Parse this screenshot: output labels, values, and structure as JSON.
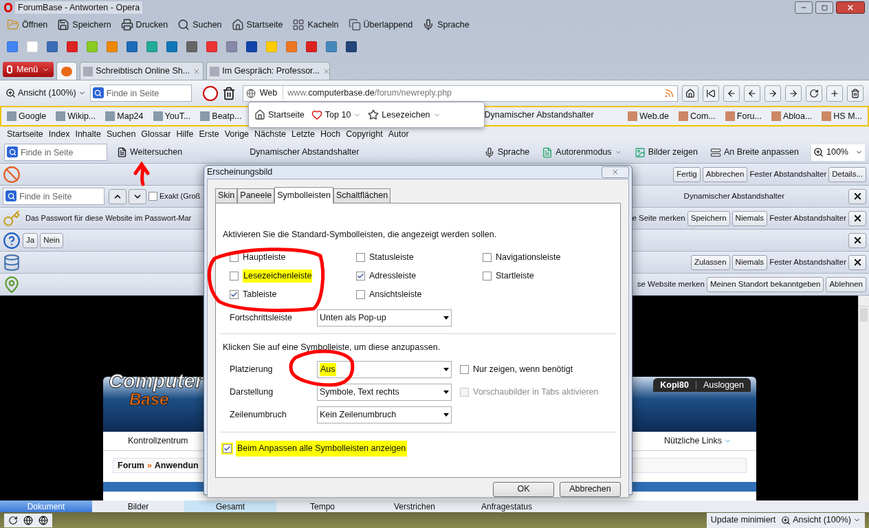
{
  "window": {
    "title": "ForumBase - Antworten - Opera"
  },
  "main_toolbar": [
    {
      "label": "Öffnen",
      "kind": "folder"
    },
    {
      "label": "Speichern",
      "kind": "save"
    },
    {
      "label": "Drucken",
      "kind": "print"
    },
    {
      "label": "Suchen",
      "kind": "search"
    },
    {
      "label": "Startseite",
      "kind": "home"
    },
    {
      "label": "Kacheln",
      "kind": "tile"
    },
    {
      "label": "Überlappend",
      "kind": "cascade"
    },
    {
      "label": "Sprache",
      "kind": "mic"
    }
  ],
  "tab_bar": {
    "menu_button": "Menü",
    "tabs": [
      {
        "kind": "icon",
        "selected": true
      },
      {
        "kind": "text",
        "label": "Schreibtisch Online Sh...",
        "selected": false
      },
      {
        "kind": "text",
        "label": "Im Gespräch: Professor...",
        "selected": false
      }
    ]
  },
  "address_bar": {
    "zoom": "Ansicht (100%)",
    "find_placeholder": "Finde in Seite",
    "search_engine": "Web",
    "url": "www.**computerbase.de**/forum/newreply.php"
  },
  "bookmarks_bar": {
    "left": [
      "Google",
      "Wikip...",
      "Map24",
      "YouT...",
      "Beatp..."
    ],
    "right": [
      "Web.de",
      "Com...",
      "Foru...",
      "Abloa...",
      "HS M..."
    ]
  },
  "bookmark_popup": {
    "items": [
      {
        "label": "Startseite",
        "kind": "home",
        "dropdown": false
      },
      {
        "label": "Top 10",
        "kind": "heart",
        "dropdown": true
      },
      {
        "label": "Lesezeichen",
        "kind": "star",
        "dropdown": true
      }
    ],
    "spacer": "Dynamischer Abstandshalter"
  },
  "navigation_menu": [
    "Startseite",
    "Index",
    "Inhalte",
    "Suchen",
    "Glossar",
    "Hilfe",
    "Erste",
    "Vorige",
    "Nächste",
    "Letzte",
    "Hoch",
    "Copyright",
    "Autor"
  ],
  "view_toolbar": {
    "find_placeholder": "Finde in Seite",
    "find_next": "Weitersuchen",
    "spacer": "Dynamischer Abstandshalter",
    "items": [
      {
        "label": "Sprache",
        "kind": "mic",
        "dropdown": false
      },
      {
        "label": "Autorenmodus",
        "kind": "author",
        "dropdown": true
      },
      {
        "label": "Bilder zeigen",
        "kind": "image",
        "dropdown": false
      },
      {
        "label": "An Breite anpassen",
        "kind": "fit",
        "dropdown": false
      }
    ],
    "zoom": "100%"
  },
  "info_bars": [
    {
      "kind": "stop",
      "buttons": [
        "Fertig",
        "Abbrechen"
      ],
      "spacer": "Fester Abstandshalter",
      "end_button": "Details...",
      "closable": false
    },
    {
      "kind": "find",
      "find_placeholder": "Finde in Seite",
      "option": {
        "label": "Exakt (Groß",
        "checked": false
      },
      "right_text": "Dynamischer Abstandshalter",
      "closable": true
    },
    {
      "kind": "key",
      "left_text": "Das Passwort für diese Website im Passwort-Mar",
      "right_text": "e Seite merken",
      "buttons": [
        "Speichern",
        "Niemals"
      ],
      "spacer": "Fester Abstandshalter",
      "closable": true
    },
    {
      "kind": "question",
      "left_buttons": [
        "Ja",
        "Nein"
      ],
      "closable": true
    },
    {
      "kind": "database",
      "buttons": [
        "Zulassen",
        "Niemals"
      ],
      "spacer": "Fester Abstandshalter",
      "closable": true
    },
    {
      "kind": "pin",
      "right_text": "se Website merken",
      "buttons": [
        "Meinen Standort bekanntgeben",
        "Ablehnen"
      ],
      "closable": false
    }
  ],
  "page": {
    "logo": [
      "Computer",
      "Base"
    ],
    "user": "Kopi80",
    "logout": "Ausloggen",
    "nav": [
      "Kontrollzentrum",
      "Nützliche Links"
    ],
    "breadcrumb": [
      "Forum",
      "Anwendun"
    ],
    "separator": "»"
  },
  "dialog": {
    "title": "Erscheinungsbild",
    "tabs": [
      {
        "label": "Skin",
        "selected": false
      },
      {
        "label": "Paneele",
        "selected": false
      },
      {
        "label": "Symbolleisten",
        "selected": true
      },
      {
        "label": "Schaltflächen",
        "selected": false
      }
    ],
    "intro": "Aktivieren Sie die Standard-Symbolleisten, die angezeigt werden sollen.",
    "toolbars": [
      {
        "label": "Hauptleiste",
        "checked": false,
        "highlighted": false
      },
      {
        "label": "Statusleiste",
        "checked": false,
        "highlighted": false
      },
      {
        "label": "Navigationsleiste",
        "checked": false,
        "highlighted": false
      },
      {
        "label": "Lesezeichenleiste",
        "checked": false,
        "highlighted": true
      },
      {
        "label": "Adressleiste",
        "checked": true,
        "highlighted": false
      },
      {
        "label": "Startleiste",
        "checked": false,
        "highlighted": false
      },
      {
        "label": "Tableiste",
        "checked": true,
        "highlighted": false
      },
      {
        "label": "Ansichtsleiste",
        "checked": false,
        "highlighted": false
      }
    ],
    "progress": {
      "label": "Fortschrittsleiste",
      "value": "Unten als Pop-up"
    },
    "customize_intro": "Klicken Sie auf eine Symbolleiste, um diese anzupassen.",
    "settings": [
      {
        "label": "Platzierung",
        "value": "Aus",
        "highlighted": true,
        "option": {
          "label": "Nur zeigen, wenn benötigt",
          "checked": false,
          "disabled": false
        }
      },
      {
        "label": "Darstellung",
        "value": "Symbole, Text rechts",
        "highlighted": false,
        "option": {
          "label": "Vorschaubilder in Tabs aktivieren",
          "checked": false,
          "disabled": true
        }
      },
      {
        "label": "Zeilenumbruch",
        "value": "Kein Zeilenumbruch",
        "highlighted": false
      }
    ],
    "show_all": {
      "label": "Beim Anpassen alle Symbolleisten anzeigen",
      "checked": true,
      "highlighted": true
    },
    "buttons": [
      "OK",
      "Abbrechen"
    ]
  },
  "status_tabs": [
    {
      "label": "Dokument",
      "selected": true
    },
    {
      "label": "Bilder",
      "selected": false
    },
    {
      "label": "Gesamt",
      "selected": false
    },
    {
      "label": "Tempo",
      "selected": false
    },
    {
      "label": "Verstrichen",
      "selected": false
    },
    {
      "label": "Anfragestatus",
      "selected": false
    }
  ],
  "status_bar": {
    "update": "Update minimiert",
    "zoom": "Ansicht (100%)"
  }
}
